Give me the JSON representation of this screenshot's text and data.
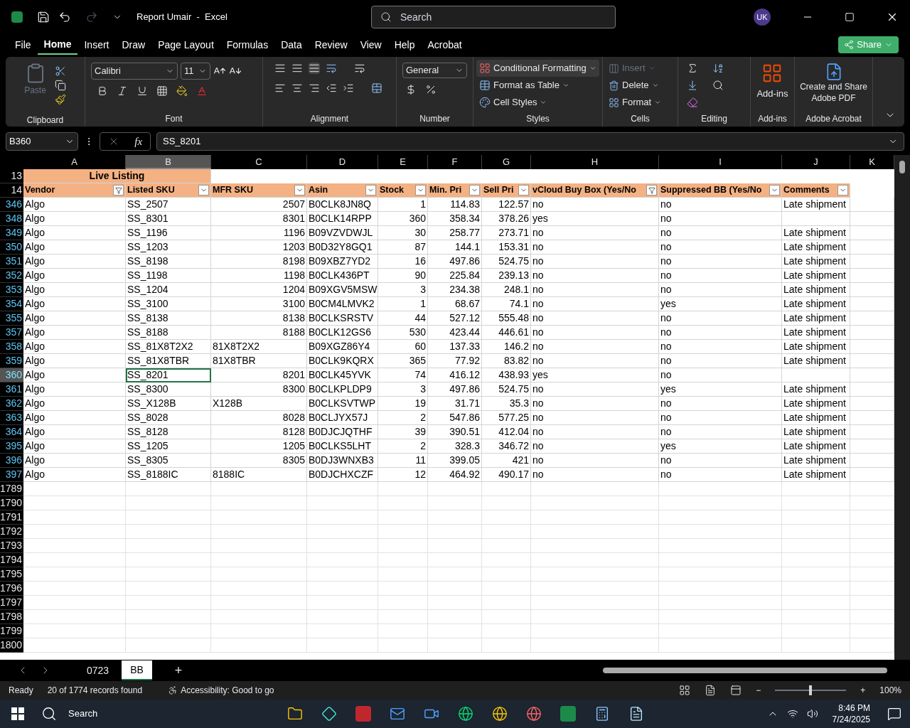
{
  "title_bar": {
    "title": "Report Umair  -  Excel",
    "search_placeholder": "Search",
    "avatar": "UK"
  },
  "menu_tabs": [
    {
      "label": "File",
      "selected": false
    },
    {
      "label": "Home",
      "selected": true
    },
    {
      "label": "Insert",
      "selected": false
    },
    {
      "label": "Draw",
      "selected": false
    },
    {
      "label": "Page Layout",
      "selected": false
    },
    {
      "label": "Formulas",
      "selected": false
    },
    {
      "label": "Data",
      "selected": false
    },
    {
      "label": "Review",
      "selected": false
    },
    {
      "label": "View",
      "selected": false
    },
    {
      "label": "Help",
      "selected": false
    },
    {
      "label": "Acrobat",
      "selected": false
    }
  ],
  "share_button": "Share",
  "ribbon": {
    "paste": "Paste",
    "clipboard_label": "Clipboard",
    "font_name": "Calibri",
    "font_size": "11",
    "font_label": "Font",
    "alignment_label": "Alignment",
    "number_format": "General",
    "number_label": "Number",
    "styles": [
      "Conditional Formatting",
      "Format as Table",
      "Cell Styles"
    ],
    "styles_label": "Styles",
    "cells": [
      {
        "label": "Insert",
        "disabled": true
      },
      {
        "label": "Delete",
        "disabled": false
      },
      {
        "label": "Format",
        "disabled": false
      }
    ],
    "cells_label": "Cells",
    "editing_label": "Editing",
    "addins_button": "Add-ins",
    "addins_label": "Add-ins",
    "acrobat_button": "Create and Share Adobe PDF",
    "acrobat_label": "Adobe Acrobat"
  },
  "formula_bar": {
    "name_box": "B360",
    "fx": "fx",
    "value": "SS_8201"
  },
  "columns": [
    {
      "label": "A",
      "selected": false
    },
    {
      "label": "B",
      "selected": true
    },
    {
      "label": "C",
      "selected": false
    },
    {
      "label": "D",
      "selected": false
    },
    {
      "label": "E",
      "selected": false
    },
    {
      "label": "F",
      "selected": false
    },
    {
      "label": "G",
      "selected": false
    },
    {
      "label": "H",
      "selected": false
    },
    {
      "label": "I",
      "selected": false
    },
    {
      "label": "J",
      "selected": false
    },
    {
      "label": "K",
      "selected": false
    }
  ],
  "banner": {
    "row": "13",
    "text": "Live Listing"
  },
  "header": {
    "row": "14",
    "cells": [
      {
        "label": "Vendor",
        "filtered": true
      },
      {
        "label": "Listed SKU",
        "filtered": false
      },
      {
        "label": "MFR SKU",
        "filtered": false
      },
      {
        "label": "Asin",
        "filtered": false
      },
      {
        "label": "Stock",
        "filtered": false
      },
      {
        "label": "Min. Pri",
        "filtered": false
      },
      {
        "label": "Sell Pri",
        "filtered": false
      },
      {
        "label": "vCloud Buy Box (Yes/No",
        "filtered": true
      },
      {
        "label": "Suppressed BB (Yes/No",
        "filtered": false
      },
      {
        "label": "Comments",
        "filtered": false
      }
    ]
  },
  "rows": [
    {
      "row": "346",
      "selected": false,
      "cells": [
        "Algo",
        "SS_2507",
        "2507",
        "B0CLK8JN8Q",
        "1",
        "114.83",
        "122.57",
        "no",
        "no",
        "Late shipment"
      ]
    },
    {
      "row": "348",
      "selected": false,
      "cells": [
        "Algo",
        "SS_8301",
        "8301",
        "B0CLK14RPP",
        "360",
        "358.34",
        "378.26",
        "yes",
        "no",
        null
      ]
    },
    {
      "row": "349",
      "selected": false,
      "cells": [
        "Algo",
        "SS_1196",
        "1196",
        "B09VZVDWJL",
        "30",
        "258.77",
        "273.71",
        "no",
        "no",
        "Late shipment"
      ]
    },
    {
      "row": "350",
      "selected": false,
      "cells": [
        "Algo",
        "SS_1203",
        "1203",
        "B0D32Y8GQ1",
        "87",
        "144.1",
        "153.31",
        "no",
        "no",
        "Late shipment"
      ]
    },
    {
      "row": "351",
      "selected": false,
      "cells": [
        "Algo",
        "SS_8198",
        "8198",
        "B09XBZ7YD2",
        "16",
        "497.86",
        "524.75",
        "no",
        "no",
        "Late shipment"
      ]
    },
    {
      "row": "352",
      "selected": false,
      "cells": [
        "Algo",
        "SS_1198",
        "1198",
        "B0CLK436PT",
        "90",
        "225.84",
        "239.13",
        "no",
        "no",
        "Late shipment"
      ]
    },
    {
      "row": "353",
      "selected": false,
      "cells": [
        "Algo",
        "SS_1204",
        "1204",
        "B09XGV5MSW",
        "3",
        "234.38",
        "248.1",
        "no",
        "no",
        "Late shipment"
      ]
    },
    {
      "row": "354",
      "selected": false,
      "cells": [
        "Algo",
        "SS_3100",
        "3100",
        "B0CM4LMVK2",
        "1",
        "68.67",
        "74.1",
        "no",
        "yes",
        "Late shipment"
      ]
    },
    {
      "row": "355",
      "selected": false,
      "cells": [
        "Algo",
        "SS_8138",
        "8138",
        "B0CLKSRSTV",
        "44",
        "527.12",
        "555.48",
        "no",
        "no",
        "Late shipment"
      ]
    },
    {
      "row": "357",
      "selected": false,
      "cells": [
        "Algo",
        "SS_8188",
        "8188",
        "B0CLK12GS6",
        "530",
        "423.44",
        "446.61",
        "no",
        "no",
        "Late shipment"
      ]
    },
    {
      "row": "358",
      "selected": false,
      "cells": [
        "Algo",
        "SS_81X8T2X2",
        "81X8T2X2",
        "B09XGZ86Y4",
        "60",
        "137.33",
        "146.2",
        "no",
        "no",
        "Late shipment"
      ]
    },
    {
      "row": "359",
      "selected": false,
      "cells": [
        "Algo",
        "SS_81X8TBR",
        "81X8TBR",
        "B0CLK9KQRX",
        "365",
        "77.92",
        "83.82",
        "no",
        "no",
        "Late shipment"
      ]
    },
    {
      "row": "360",
      "selected": true,
      "cells": [
        "Algo",
        "SS_8201",
        "8201",
        "B0CLK45YVK",
        "74",
        "416.12",
        "438.93",
        "yes",
        "no",
        null
      ]
    },
    {
      "row": "361",
      "selected": false,
      "cells": [
        "Algo",
        "SS_8300",
        "8300",
        "B0CLKPLDP9",
        "3",
        "497.86",
        "524.75",
        "no",
        "yes",
        "Late shipment"
      ]
    },
    {
      "row": "362",
      "selected": false,
      "cells": [
        "Algo",
        "SS_X128B",
        "X128B",
        "B0CLKSVTWP",
        "19",
        "31.71",
        "35.3",
        "no",
        "no",
        "Late shipment"
      ]
    },
    {
      "row": "363",
      "selected": false,
      "cells": [
        "Algo",
        "SS_8028",
        "8028",
        "B0CLJYX57J",
        "2",
        "547.86",
        "577.25",
        "no",
        "no",
        "Late shipment"
      ]
    },
    {
      "row": "364",
      "selected": false,
      "cells": [
        "Algo",
        "SS_8128",
        "8128",
        "B0DJCJQTHF",
        "39",
        "390.51",
        "412.04",
        "no",
        "no",
        "Late shipment"
      ]
    },
    {
      "row": "395",
      "selected": false,
      "cells": [
        "Algo",
        "SS_1205",
        "1205",
        "B0CLKS5LHT",
        "2",
        "328.3",
        "346.72",
        "no",
        "yes",
        "Late shipment"
      ]
    },
    {
      "row": "396",
      "selected": false,
      "cells": [
        "Algo",
        "SS_8305",
        "8305",
        "B0DJ3WNXB3",
        "11",
        "399.05",
        "421",
        "no",
        "no",
        "Late shipment"
      ]
    },
    {
      "row": "397",
      "selected": false,
      "cells": [
        "Algo",
        "SS_8188IC",
        "8188IC",
        "B0DJCHXCZF",
        "12",
        "464.92",
        "490.17",
        "no",
        "no",
        "Late shipment"
      ]
    }
  ],
  "empty_rows": [
    "1789",
    "1790",
    "1791",
    "1792",
    "1793",
    "1794",
    "1795",
    "1796",
    "1797",
    "1798",
    "1799",
    "1800"
  ],
  "sheet_tabs": [
    {
      "label": "0723",
      "selected": false
    },
    {
      "label": "BB",
      "selected": true
    }
  ],
  "add_sheet": "+",
  "status_bar": {
    "mode": "Ready",
    "records": "20 of 1774 records found",
    "accessibility": "Accessibility: Good to go",
    "zoom_out": "−",
    "zoom_in": "+",
    "zoom": "100%",
    "level": 0.5
  },
  "taskbar": {
    "search": "Search",
    "time": "8:46 PM",
    "date": "7/24/2025"
  }
}
